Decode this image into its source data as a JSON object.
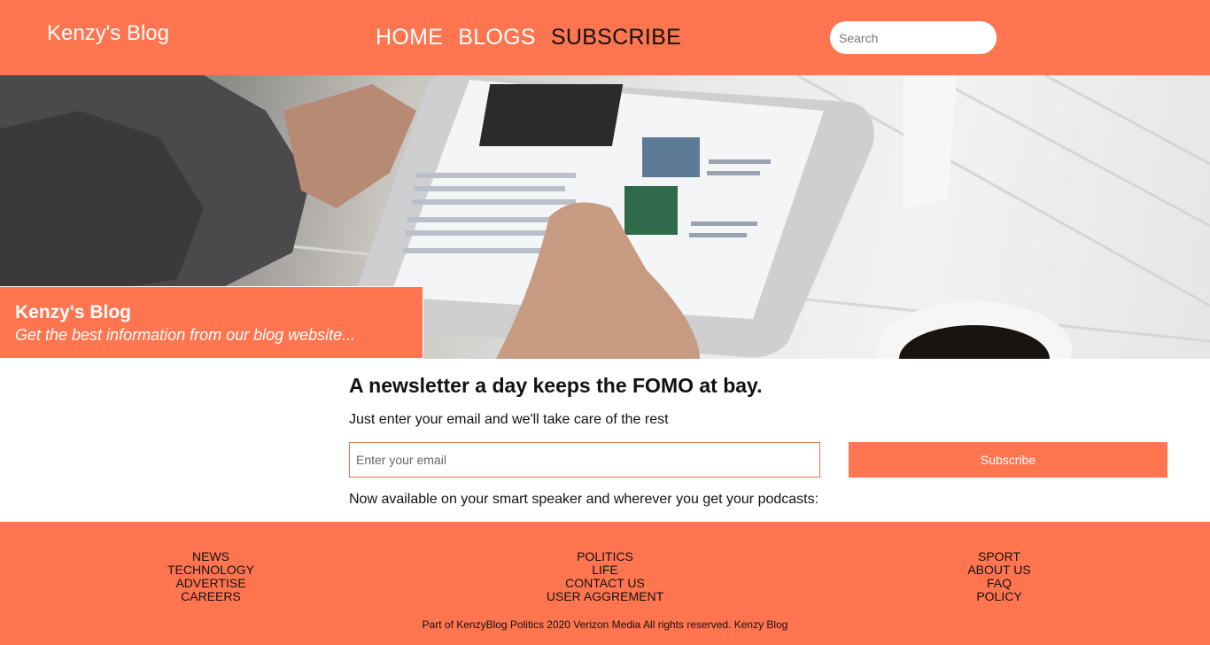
{
  "header": {
    "brand": "Kenzy's Blog",
    "nav": [
      {
        "label": "HOME"
      },
      {
        "label": "BLOGS"
      },
      {
        "label": "SUBSCRIBE"
      }
    ],
    "search_placeholder": "Search"
  },
  "hero": {
    "title": "Kenzy's Blog",
    "subtitle": "Get the best information from our blog website..."
  },
  "newsletter": {
    "heading": "A newsletter a day keeps the FOMO at bay.",
    "text": "Just enter your email and we'll take care of the rest",
    "email_placeholder": "Enter your email",
    "button_label": "Subscribe",
    "podcast_text": "Now available on your smart speaker and wherever you get your podcasts:"
  },
  "footer": {
    "columns": [
      [
        "NEWS",
        "TECHNOLOGY",
        "ADVERTISE",
        "CAREERS"
      ],
      [
        "POLITICS",
        "LIFE",
        "CONTACT US",
        "USER AGGREMENT"
      ],
      [
        "SPORT",
        "ABOUT US",
        "FAQ",
        "POLICY"
      ]
    ],
    "copyright": "Part of KenzyBlog Politics 2020 Verizon Media All rights reserved. Kenzy Blog"
  },
  "colors": {
    "accent": "#ff7550",
    "text": "#111111"
  }
}
